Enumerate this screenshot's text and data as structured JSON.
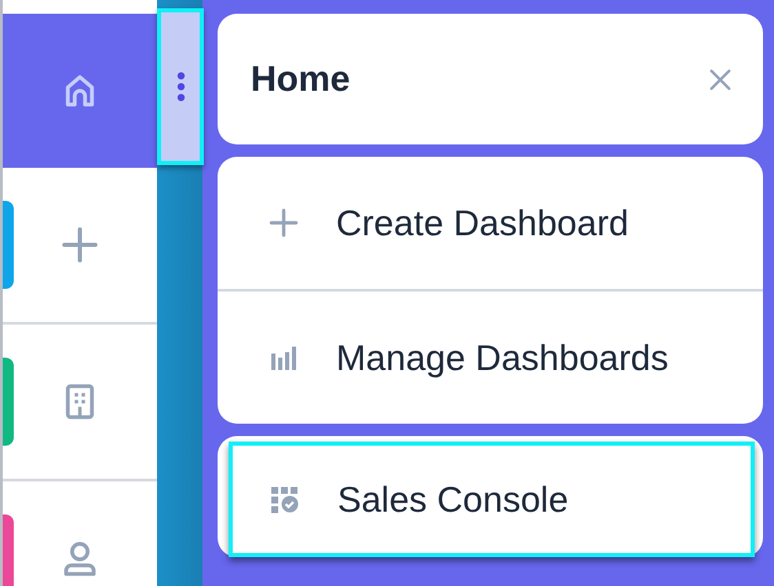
{
  "rail": {
    "items": [
      {
        "kind": "home",
        "selected": true
      },
      {
        "kind": "plus",
        "selected": false,
        "color": "#0ea5e9"
      },
      {
        "kind": "building",
        "selected": false,
        "color": "#10b981"
      },
      {
        "kind": "user",
        "selected": false,
        "color": "#ec4899"
      }
    ]
  },
  "handle": {
    "highlighted": true
  },
  "panel": {
    "title": "Home",
    "groups": [
      {
        "items": [
          {
            "kind": "plus",
            "label": "Create Dashboard",
            "highlighted": false
          },
          {
            "kind": "bars",
            "label": "Manage Dashboards",
            "highlighted": false
          }
        ]
      },
      {
        "items": [
          {
            "kind": "console",
            "label": "Sales Console",
            "highlighted": true
          }
        ]
      }
    ]
  }
}
